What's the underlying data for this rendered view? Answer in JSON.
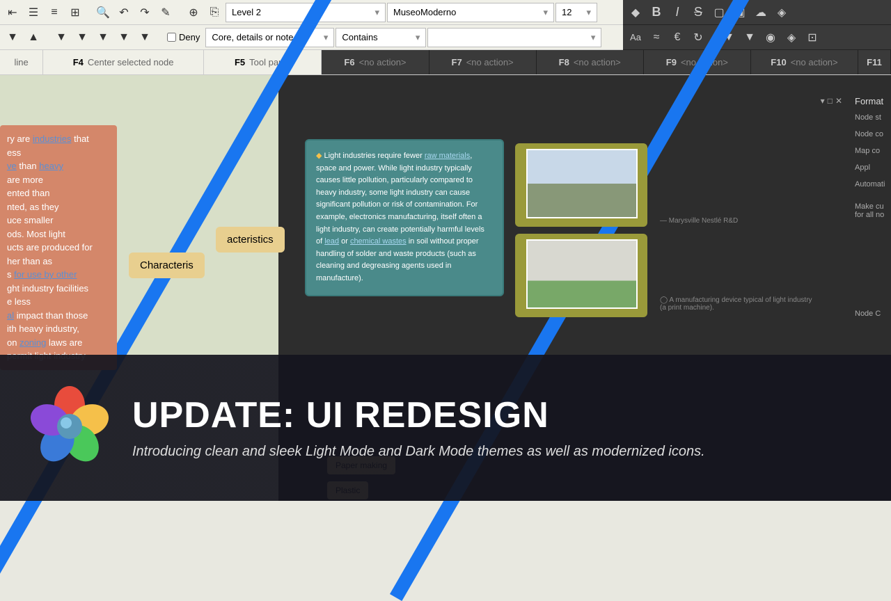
{
  "toolbar": {
    "style_dropdown": "Level 2",
    "font_dropdown": "MuseoModerno",
    "fontsize_dropdown": "12",
    "deny_label": "Deny",
    "filter_placeholder": "Core, details or note",
    "contains_label": "Contains"
  },
  "fkeys": [
    {
      "key": "",
      "action": "line"
    },
    {
      "key": "F4",
      "action": "Center selected node"
    },
    {
      "key": "F5",
      "action": "Tool panel"
    },
    {
      "key": "F6",
      "action": "<no action>"
    },
    {
      "key": "F7",
      "action": "<no action>"
    },
    {
      "key": "F8",
      "action": "<no action>"
    },
    {
      "key": "F9",
      "action": "<no action>"
    },
    {
      "key": "F10",
      "action": "<no action>"
    },
    {
      "key": "F11",
      "action": ""
    }
  ],
  "nodes": {
    "char1": "Characteris",
    "char2": "acteristics"
  },
  "orange_card": {
    "t1": "ry are ",
    "l1": "industries",
    "t2": " that",
    "t3": "ess",
    "l2": "ve",
    "t4": " than ",
    "l3": "heavy",
    "t5": "are more",
    "t6": "ented than",
    "t7": "nted, as they",
    "t8": "uce smaller",
    "t9": "ods. Most light",
    "t10": "ucts are produced for",
    "t11": "her than as",
    "t12": "s ",
    "l4": "for use by other",
    "t13": "ght industry facilities",
    "t14": "e less",
    "l5": "al",
    "t15": " impact than those",
    "t16": "ith heavy industry,",
    "t17": "on ",
    "l6": "zoning",
    "t18": " laws are",
    "t19": "permit light industry"
  },
  "teal_card": {
    "pre": "Light industries require fewer ",
    "l1": "raw materials",
    "mid": ", space and power. While light industry typically causes little pollution, particularly compared to heavy industry, some light industry can cause significant pollution or risk of contamination. For example, electronics manufacturing, itself often a light industry, can create potentially harmful levels of ",
    "l2": "lead",
    "or": " or ",
    "l3": "chemical wastes",
    "post": " in soil without proper handling of solder and waste products (such as cleaning and degreasing agents used in manufacture)."
  },
  "captions": {
    "c1": "Marysville Nestlé R&D",
    "c2": "A manufacturing device typical of light industry (a print machine)."
  },
  "format_panel": {
    "title": "Format",
    "nodestyle": "Node st",
    "nodeco": "Node co",
    "mapco": "Map co",
    "apply": "Appl",
    "auto": "Automati",
    "make": "Make cu",
    "forall": "for all no",
    "nodec2": "Node C"
  },
  "chips": {
    "paper": "Paper making",
    "plastic": "Plastic"
  },
  "banner": {
    "title": "UPDATE: UI REDESIGN",
    "subtitle": "Introducing clean and sleek Light Mode and Dark Mode themes as well as modernized icons."
  }
}
